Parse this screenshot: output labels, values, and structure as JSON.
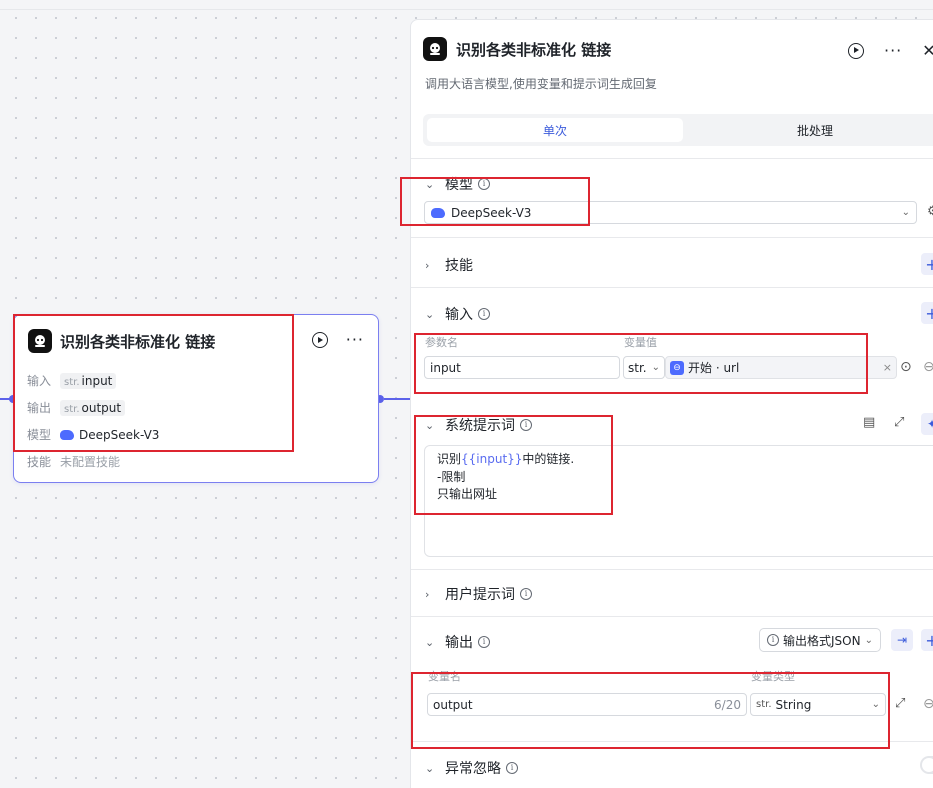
{
  "node": {
    "title": "识别各类非标准化 链接",
    "input_label": "输入",
    "input_type": "str.",
    "input_value": "input",
    "output_label": "输出",
    "output_type": "str.",
    "output_value": "output",
    "model_label": "模型",
    "model_value": "DeepSeek-V3",
    "skill_label": "技能",
    "skill_value": "未配置技能"
  },
  "panel": {
    "title": "识别各类非标准化 链接",
    "description": "调用大语言模型,使用变量和提示词生成回复",
    "tabs": [
      {
        "label": "单次",
        "active": true
      },
      {
        "label": "批处理",
        "active": false
      }
    ],
    "model_section": {
      "label": "模型",
      "selected": "DeepSeek-V3"
    },
    "skills_section": {
      "label": "技能"
    },
    "input_section": {
      "label": "输入",
      "col_name": "参数名",
      "col_value": "变量值",
      "param_name": "input",
      "param_type": "str.",
      "ref_value": "开始 · url"
    },
    "system_prompt": {
      "label": "系统提示词",
      "line1_before": "识别",
      "line1_var": "{{input}}",
      "line1_after": "中的链接.",
      "line2": "-限制",
      "line3": "只输出网址"
    },
    "user_prompt": {
      "label": "用户提示词"
    },
    "output_section": {
      "label": "输出",
      "format_button": "输出格式JSON",
      "col_name": "变量名",
      "col_type": "变量类型",
      "var_name": "output",
      "counter": "6/20",
      "type_prefix": "str.",
      "type_value": "String"
    },
    "exception_section": {
      "label": "异常忽略"
    }
  },
  "colors": {
    "accent": "#3b5bdb",
    "highlight": "#dd2530",
    "edge": "#5c62ea"
  }
}
